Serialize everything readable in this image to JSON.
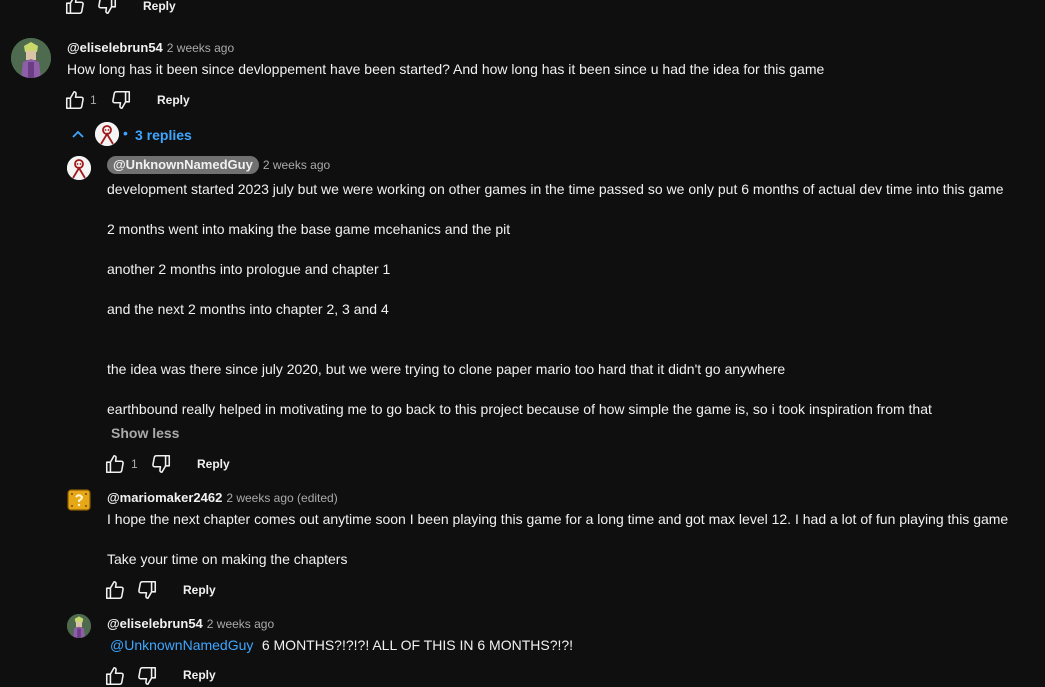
{
  "top_actions": {
    "reply_label": "Reply"
  },
  "comment1": {
    "author": "@eliselebrun54",
    "time": "2 weeks ago",
    "text": "How long has it been since devloppement have been started? And how long has it been since u had the idea for this game",
    "like_count": "1",
    "reply_label": "Reply",
    "replies_toggle": "3 replies",
    "replies_dot": "•"
  },
  "reply1": {
    "author": "@UnknownNamedGuy",
    "time": "2 weeks ago",
    "lines": [
      "development started 2023 july but we were working on other games in the time passed so we only put 6 months of actual dev time into this game",
      "2 months went into making the base game mcehanics and the pit",
      "another 2 months into prologue and chapter 1",
      "and the next 2 months into chapter 2, 3 and 4",
      "the idea was there since july 2020, but we were trying to clone paper mario too hard that it didn't go anywhere",
      "earthbound really helped in motivating me to go back to this project because of how simple the game is, so i took inspiration from that"
    ],
    "show_less": "Show less",
    "like_count": "1",
    "reply_label": "Reply"
  },
  "reply2": {
    "author": "@mariomaker2462",
    "time": "2 weeks ago (edited)",
    "lines": [
      "I hope the next chapter comes out anytime soon I been playing this game for a long time and got max level 12. I had a lot of fun playing this game",
      "Take your time on making the chapters"
    ],
    "reply_label": "Reply"
  },
  "reply3": {
    "author": "@eliselebrun54",
    "time": "2 weeks ago",
    "mention": "@UnknownNamedGuy",
    "text": "6 MONTHS?!?!?! ALL OF THIS IN 6 MONTHS?!?!",
    "reply_label": "Reply"
  },
  "icons": {
    "like": "thumbs-up-icon",
    "dislike": "thumbs-down-icon",
    "collapse": "chevron-up-icon"
  },
  "colors": {
    "background": "#0f0f0f",
    "link": "#3ea6ff",
    "muted": "#aaaaaa"
  }
}
